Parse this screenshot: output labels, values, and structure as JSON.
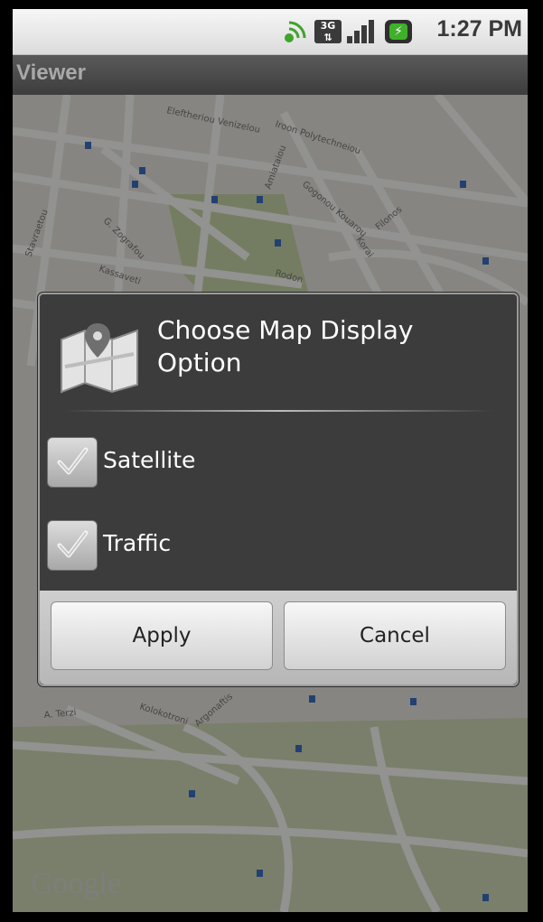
{
  "status_bar": {
    "time": "1:27 PM",
    "network_label": "3G",
    "icons": [
      "sync-icon",
      "3g-network-icon",
      "signal-icon",
      "battery-charging-icon"
    ],
    "battery_color": "#3fb02a"
  },
  "app": {
    "title": "Viewer"
  },
  "map": {
    "attribution": "Google",
    "street_labels": [
      "Eleftheriou Venizelou",
      "Iroon Polytechneiou",
      "Kassaveti",
      "Rodon",
      "G. Zografou",
      "Stavraetou",
      "Amiataiou",
      "Filonos",
      "Korai",
      "Kolokotroni",
      "Argonaftis",
      "A. Terzi",
      "Gogonou Kouarou"
    ]
  },
  "dialog": {
    "title": "Choose Map Display Option",
    "icon": "map-icon",
    "options": [
      {
        "label": "Satellite",
        "checked": true
      },
      {
        "label": "Traffic",
        "checked": true
      }
    ],
    "buttons": {
      "apply": "Apply",
      "cancel": "Cancel"
    }
  }
}
